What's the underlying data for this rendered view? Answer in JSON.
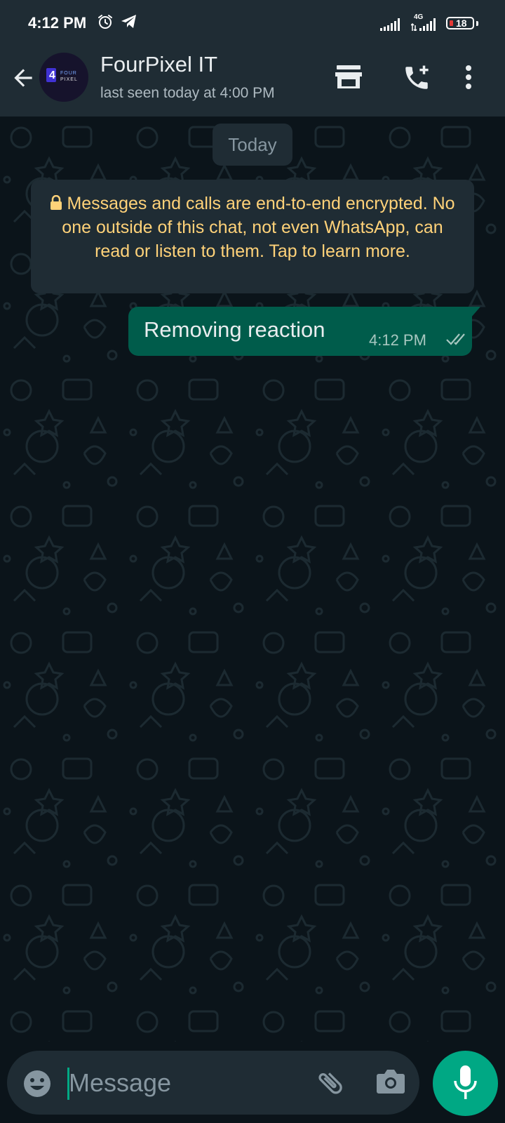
{
  "status_bar": {
    "time": "4:12 PM",
    "network": "4G",
    "battery": "18",
    "icons": [
      "alarm-icon",
      "telegram-icon",
      "signal-icon",
      "signal-4g-icon",
      "battery-icon"
    ]
  },
  "header": {
    "contact_name": "FourPixel IT",
    "last_seen": "last seen today at 4:00 PM",
    "avatar_number": "4",
    "avatar_line1": "FOUR",
    "avatar_line2": "PIXEL",
    "icons": [
      "back-arrow-icon",
      "store-icon",
      "add-call-icon",
      "more-vert-icon"
    ]
  },
  "chat": {
    "date_chip": "Today",
    "encryption_notice": "Messages and calls are end-to-end encrypted. No one outside of this chat, not even WhatsApp, can read or listen to them. Tap to learn more.",
    "messages": [
      {
        "text": "Removing reaction",
        "time": "4:12 PM",
        "status": "read",
        "outgoing": true
      }
    ]
  },
  "input_bar": {
    "placeholder": "Message",
    "icons": [
      "emoji-icon",
      "attach-icon",
      "camera-icon",
      "mic-icon"
    ]
  },
  "colors": {
    "background": "#0b141a",
    "header": "#1f2c34",
    "outgoing_bubble": "#005c4b",
    "accent": "#00a884",
    "encryption_text": "#ffd279"
  }
}
